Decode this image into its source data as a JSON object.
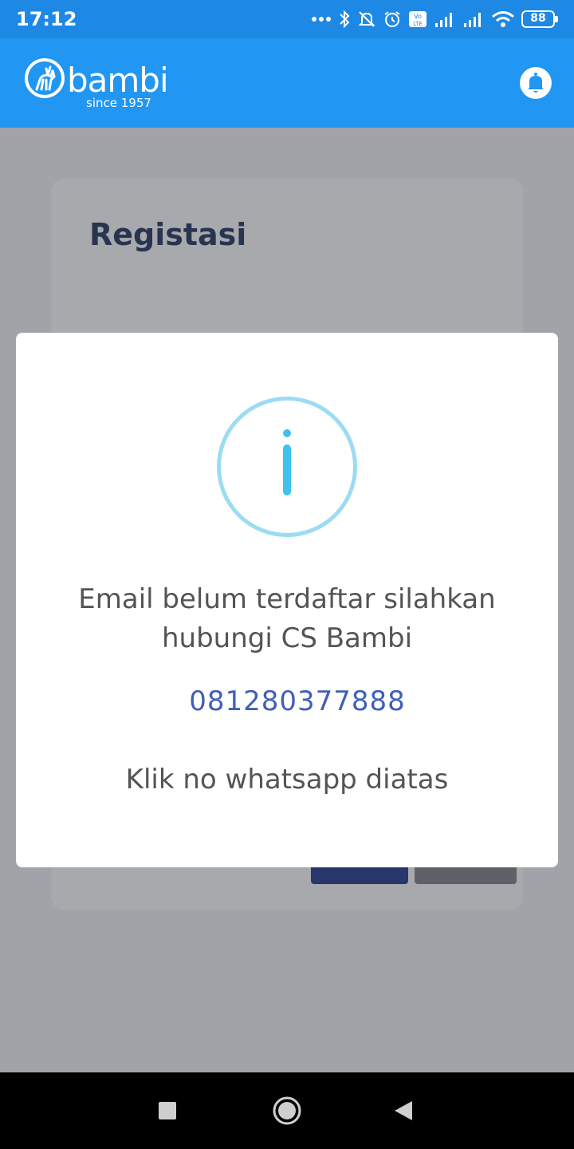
{
  "status_bar": {
    "time": "17:12",
    "battery": "88",
    "icons": [
      "more-dots-icon",
      "bluetooth-icon",
      "muted-bell-icon",
      "alarm-icon",
      "volte-icon",
      "signal-icon",
      "signal-icon",
      "wifi-icon",
      "battery-icon"
    ]
  },
  "app_bar": {
    "brand": "bambi",
    "tagline": "since 1957",
    "notification_icon": "bell-icon"
  },
  "page": {
    "title": "Registasi"
  },
  "dialog": {
    "icon": "info-icon",
    "message": "Email belum terdaftar silahkan hubungi CS Bambi",
    "phone": "081280377888",
    "hint": "Klik no whatsapp diatas"
  },
  "colors": {
    "app_bar": "#2196f3",
    "status_bar": "#1e88e5",
    "title": "#1a2a5a",
    "info_accent": "#3fc3ee",
    "phone_link": "#3f5fb8"
  },
  "nav_bar": {
    "buttons": [
      "recents-square-icon",
      "home-circle-icon",
      "back-triangle-icon"
    ]
  }
}
